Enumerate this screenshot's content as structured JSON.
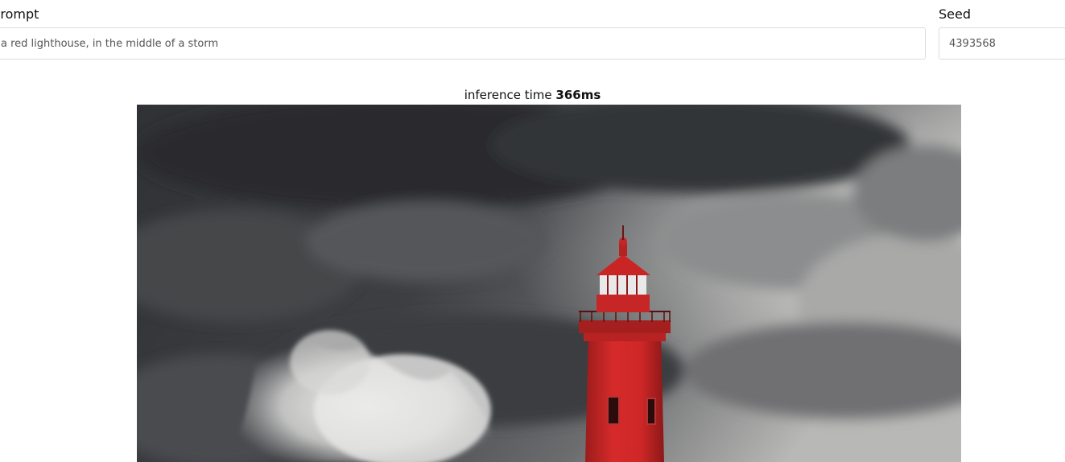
{
  "form": {
    "prompt_label": "Prompt",
    "prompt_value": "a red lighthouse, in the middle of a storm",
    "seed_label": "Seed",
    "seed_value": "4393568"
  },
  "result": {
    "inference_prefix": "inference time",
    "inference_value": "366ms",
    "image_subject": "red lighthouse in a storm with crashing waves"
  },
  "colors": {
    "lighthouse_red": "#d52a2a",
    "storm_dark": "#3c3e42",
    "storm_light": "#c9c9c7"
  }
}
